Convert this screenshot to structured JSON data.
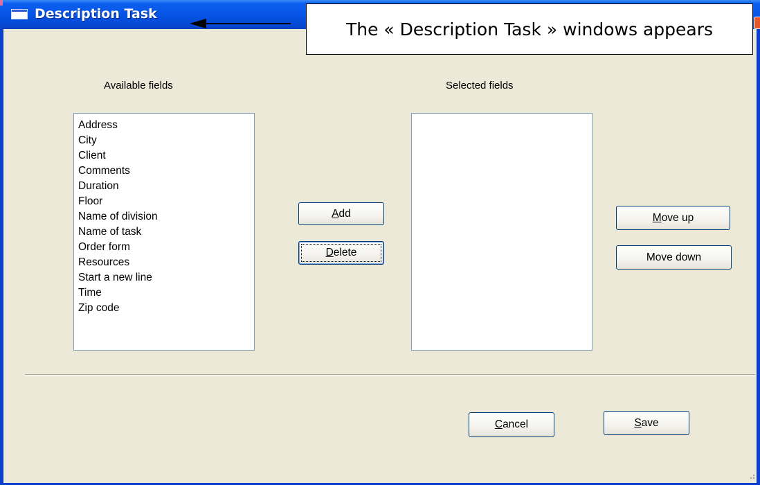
{
  "window": {
    "title": "Description Task"
  },
  "callout": {
    "text": "The « Description Task » windows appears"
  },
  "available": {
    "label": "Available fields",
    "items": [
      "Address",
      "City",
      "Client",
      "Comments",
      "Duration",
      "Floor",
      "Name of division",
      "Name of task",
      "Order form",
      "Resources",
      "Start a new line",
      "Time",
      "Zip code"
    ]
  },
  "selected": {
    "label": "Selected fields",
    "items": []
  },
  "buttons": {
    "add": {
      "mnemonic": "A",
      "rest": "dd"
    },
    "delete": {
      "mnemonic": "D",
      "rest": "elete"
    },
    "move_up": {
      "mnemonic": "M",
      "rest": "ove up"
    },
    "move_down": {
      "label": "Move down"
    },
    "cancel": {
      "mnemonic": "C",
      "rest": "ancel"
    },
    "save": {
      "mnemonic": "S",
      "rest": "ave"
    }
  },
  "colors": {
    "titlebar": "#0654e6",
    "dialog_bg": "#ece9d8",
    "button_border": "#003c74",
    "close_button": "#e4572e"
  },
  "icons": [
    "window-icon",
    "close-icon",
    "arrow-icon",
    "resize-grip-icon"
  ]
}
